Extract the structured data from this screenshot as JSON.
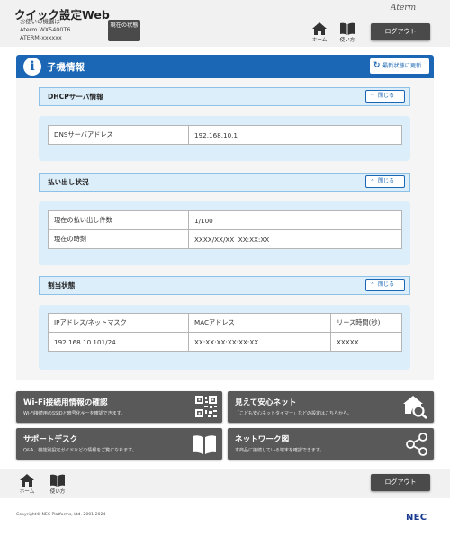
{
  "header": {
    "app_title": "クイック設定Web",
    "device_label": "お使いの機器は",
    "device_model": "Aterm WX5400T6",
    "device_id": "ATERM-xxxxxx",
    "status_button": "現在の状態",
    "brand": "Aterm",
    "home_label": "ホーム",
    "help_label": "使い方",
    "logout_label": "ログアウト"
  },
  "page": {
    "title": "子機情報",
    "refresh_label": "最新状態に更新"
  },
  "sections": {
    "dhcp": {
      "title": "DHCPサーバ情報",
      "close_label": "閉じる",
      "rows": [
        [
          "DNSサーバアドレス",
          "192.168.10.1"
        ]
      ]
    },
    "lease": {
      "title": "払い出し状況",
      "close_label": "閉じる",
      "rows": [
        [
          "現在の払い出し件数",
          "1/100"
        ],
        [
          "現在の時刻",
          "XXXX/XX/XX  XX:XX:XX"
        ]
      ]
    },
    "assign": {
      "title": "割当状態",
      "close_label": "閉じる",
      "headers": [
        "IPアドレス/ネットマスク",
        "MACアドレス",
        "リース時間(秒)"
      ],
      "rows": [
        [
          "192.168.10.101/24",
          "XX:XX:XX:XX:XX:XX",
          "XXXXX"
        ]
      ]
    }
  },
  "quick_links": [
    {
      "title": "Wi-Fi接続用情報の確認",
      "desc": "Wi-Fi接続用のSSIDと暗号化キーを確認できます。",
      "icon": "qr-code-icon"
    },
    {
      "title": "見えて安心ネット",
      "desc": "「こども安心ネットタイマー」などの設定はこちらから。",
      "icon": "home-search-icon"
    },
    {
      "title": "サポートデスク",
      "desc": "Q&A、機能別設定ガイドなどの情報をご覧になれます。",
      "icon": "book-icon"
    },
    {
      "title": "ネットワーク図",
      "desc": "本商品に接続している端末を確認できます。",
      "icon": "network-icon"
    }
  ],
  "footer": {
    "home_label": "ホーム",
    "help_label": "使い方",
    "logout_label": "ログアウト",
    "copyright": "Copyright© NEC Platforms, Ltd. 2001-2024",
    "brand": "NEC"
  },
  "colors": {
    "primary": "#1b67b5",
    "section_bg": "#dceefa",
    "dark_button": "#4a4a4a"
  }
}
